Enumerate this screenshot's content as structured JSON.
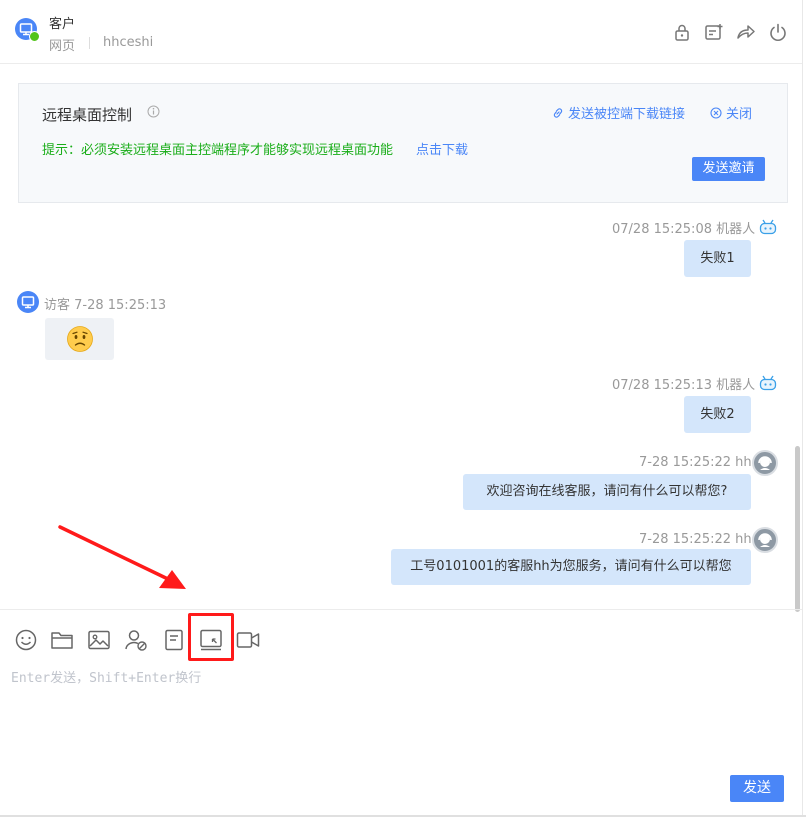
{
  "header": {
    "customer_label": "客户",
    "channel": "网页",
    "site": "hhceshi",
    "icons": [
      "lock-icon",
      "note-add-icon",
      "transfer-icon",
      "power-icon"
    ]
  },
  "remote_desktop": {
    "title": "远程桌面控制",
    "send_link_label": "发送被控端下载链接",
    "close_label": "关闭",
    "tip": "提示：必须安装远程桌面主控端程序才能够实现远程桌面功能",
    "download_label": "点击下载",
    "invite_button": "发送邀请"
  },
  "messages": [
    {
      "side": "right",
      "sender": "机器人",
      "time": "07/28 15:25:08",
      "meta": "07/28 15:25:08 机器人",
      "text": "失败1"
    },
    {
      "side": "left",
      "sender": "访客",
      "time": "7-28 15:25:13",
      "meta": "访客 7-28 15:25:13",
      "emoji": "😟"
    },
    {
      "side": "right",
      "sender": "机器人",
      "time": "07/28 15:25:13",
      "meta": "07/28 15:25:13 机器人",
      "text": "失败2"
    },
    {
      "side": "right",
      "sender": "hh",
      "time": "7-28 15:25:22",
      "meta": "7-28 15:25:22 hh",
      "text": "欢迎咨询在线客服，请问有什么可以帮您?"
    },
    {
      "side": "right",
      "sender": "hh",
      "time": "7-28 15:25:22",
      "meta": "7-28 15:25:22 hh",
      "text": "工号0101001的客服hh为您服务，请问有什么可以帮您"
    }
  ],
  "toolbar": {
    "tools": [
      "emoji-icon",
      "folder-icon",
      "image-icon",
      "user-block-icon",
      "document-icon",
      "remote-desktop-icon",
      "video-icon"
    ],
    "highlighted_tool": "remote-desktop-icon"
  },
  "input": {
    "placeholder": "Enter发送，Shift+Enter换行",
    "send_label": "发送"
  },
  "colors": {
    "accent": "#4a86f7",
    "tip_green": "#1aad19",
    "bubble_blue": "#d4e6fb",
    "highlight_red": "#ff1a1a"
  }
}
